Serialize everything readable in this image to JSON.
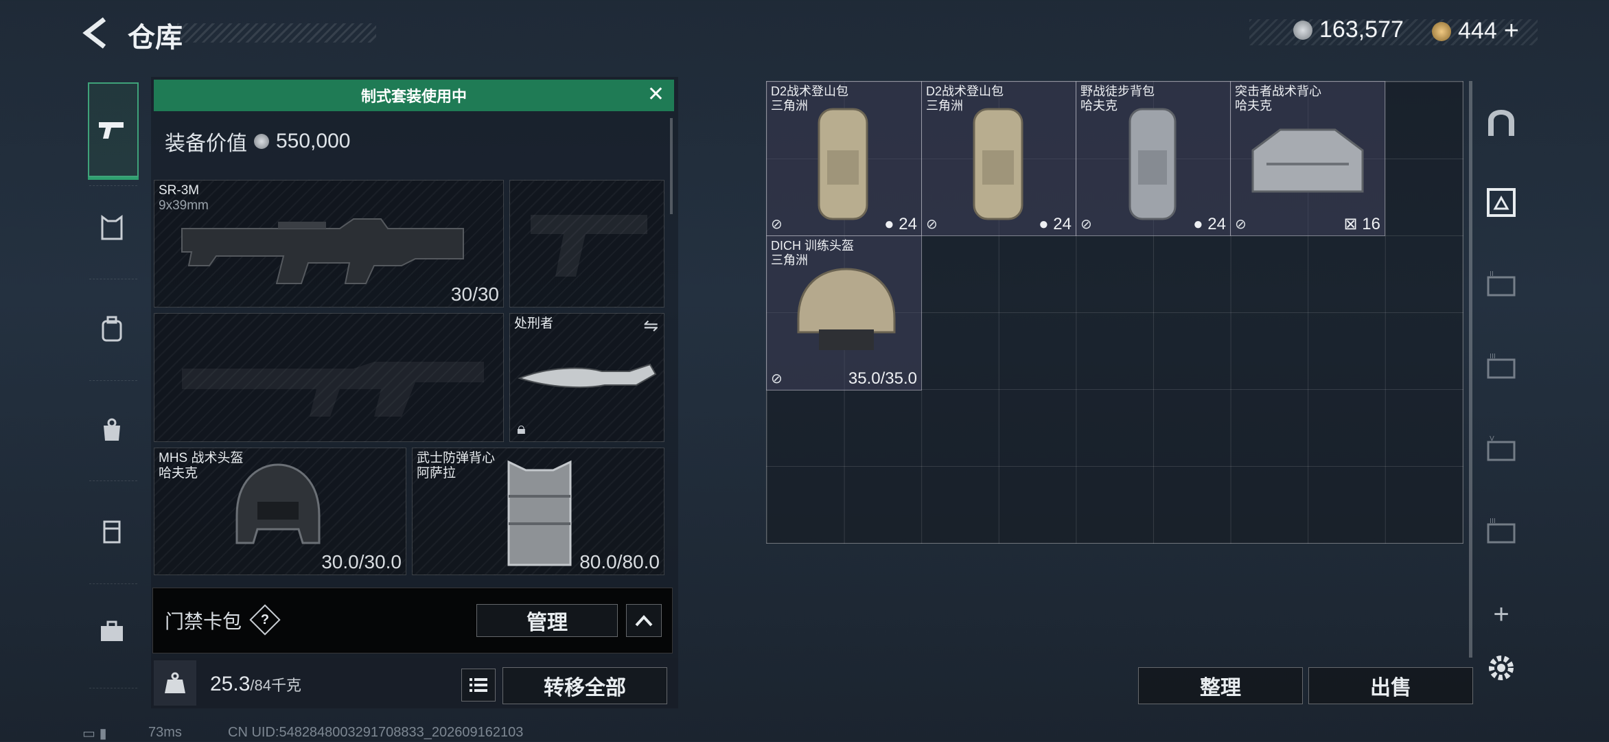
{
  "header": {
    "title": "仓库",
    "currency_silver": "163,577",
    "currency_gold": "444",
    "add": "+"
  },
  "left_nav": {
    "items": [
      "pistol-icon",
      "armor-icon",
      "backpack-icon",
      "pouch-icon",
      "case-icon",
      "toolbox-icon"
    ]
  },
  "loadout": {
    "banner": "制式套装使用中",
    "value_label": "装备价值",
    "value": "550,000",
    "primary": {
      "name": "SR-3M",
      "ammo": "9x39mm",
      "count": "30/30"
    },
    "melee": {
      "name": "处刑者"
    },
    "helmet": {
      "name": "MHS 战术头盔",
      "map": "哈夫克",
      "durability": "30.0/30.0"
    },
    "armor": {
      "name": "武士防弹背心",
      "map": "阿萨拉",
      "durability": "80.0/80.0"
    },
    "keycard_label": "门禁卡包",
    "keycard_help": "?",
    "manage_button": "管理",
    "weight": "25.3",
    "weight_max": "/84千克",
    "transfer_all": "转移全部"
  },
  "stash": {
    "items": [
      {
        "name": "D2战术登山包",
        "map": "三角洲",
        "count": "24"
      },
      {
        "name": "D2战术登山包",
        "map": "三角洲",
        "count": "24"
      },
      {
        "name": "野战徒步背包",
        "map": "哈夫克",
        "count": "24"
      },
      {
        "name": "突击者战术背心",
        "map": "哈夫克",
        "count": "16"
      },
      {
        "name": "DICH 训练头盔",
        "map": "三角洲",
        "durability": "35.0/35.0"
      }
    ],
    "sort_button": "整理",
    "sell_button": "出售"
  },
  "status": {
    "ping": "73ms",
    "uid": "CN UID:5482848003291708833_202609162103"
  },
  "colors": {
    "accent_green": "#1f7b55",
    "item_bg": "#464864"
  }
}
